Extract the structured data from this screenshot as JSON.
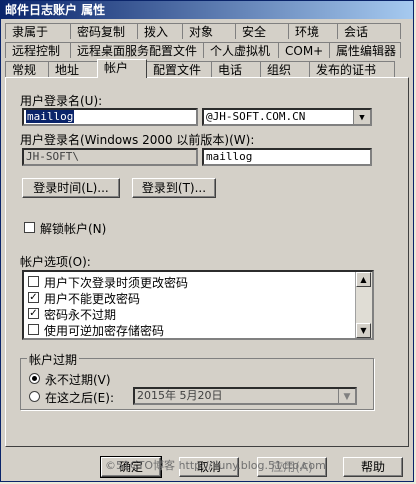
{
  "window": {
    "title": "邮件日志账户 属性"
  },
  "tabs": {
    "row1": [
      "隶属于",
      "密码复制",
      "拨入",
      "对象",
      "安全",
      "环境",
      "会话"
    ],
    "row2": [
      "远程控制",
      "远程桌面服务配置文件",
      "个人虚拟机",
      "COM+",
      "属性编辑器"
    ],
    "row3": [
      "常规",
      "地址",
      "帐户",
      "配置文件",
      "电话",
      "组织",
      "发布的证书"
    ]
  },
  "account": {
    "logon_label": "用户登录名(U):",
    "logon_value": "maillog",
    "domain_value": "@JH-SOFT.COM.CN",
    "pre2000_label": "用户登录名(Windows 2000 以前版本)(W):",
    "pre2000_domain": "JH-SOFT\\",
    "pre2000_value": "maillog",
    "logon_hours_button": "登录时间(L)...",
    "logon_to_button": "登录到(T)...",
    "unlock_label": "解锁帐户(N)"
  },
  "options": {
    "label": "帐户选项(O):",
    "items": [
      {
        "text": "用户下次登录时须更改密码",
        "checked": false
      },
      {
        "text": "用户不能更改密码",
        "checked": true
      },
      {
        "text": "密码永不过期",
        "checked": true
      },
      {
        "text": "使用可逆加密存储密码",
        "checked": false
      }
    ],
    "check_mark": "✓"
  },
  "expiry": {
    "title": "帐户过期",
    "never_label": "永不过期(V)",
    "end_label": "在这之后(E):",
    "date_value": "2015年 5月20日"
  },
  "footer": {
    "ok": "确定",
    "cancel": "取消",
    "apply": "应用(A)",
    "help": "帮助"
  },
  "watermark": "©51CTO博客 http://lluny.blog.51cto.com"
}
